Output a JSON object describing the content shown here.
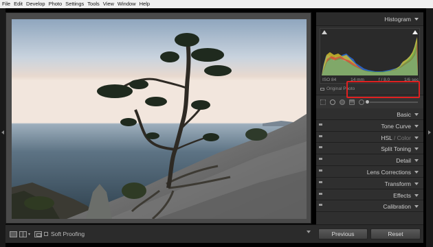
{
  "menu": {
    "items": [
      "File",
      "Edit",
      "Develop",
      "Photo",
      "Settings",
      "Tools",
      "View",
      "Window",
      "Help"
    ]
  },
  "histogram": {
    "title": "Histogram",
    "iso": "ISO 84",
    "focal": "14 mm",
    "aperture": "f / 8.0",
    "shutter": "1/6 sec",
    "original_photo_label": "Original Photo"
  },
  "panels": {
    "sections": [
      {
        "label": "Basic"
      },
      {
        "label": "Tone Curve"
      },
      {
        "label": "HSL",
        "secondary": "/ Color"
      },
      {
        "label": "Split Toning"
      },
      {
        "label": "Detail"
      },
      {
        "label": "Lens Corrections"
      },
      {
        "label": "Transform"
      },
      {
        "label": "Effects"
      },
      {
        "label": "Calibration"
      }
    ],
    "previous_label": "Previous",
    "reset_label": "Reset"
  },
  "toolbar": {
    "soft_proofing_label": "Soft Proofing"
  },
  "colors": {
    "panel_bg": "#2f2f2f",
    "highlight_box": "#e02020",
    "text": "#cdcdcd"
  },
  "icons": {
    "histogram_clip_left": "shadow-clip-icon",
    "histogram_clip_right": "highlight-clip-icon",
    "section_switch": "panel-switch-icon"
  }
}
